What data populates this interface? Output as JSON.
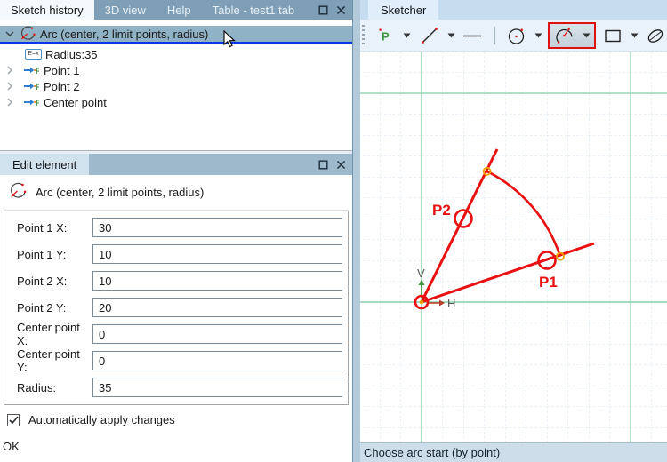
{
  "sketch_history_panel": {
    "tabs": {
      "active": "Sketch history",
      "tab_3d": "3D view",
      "tab_help": "Help",
      "tab_table": "Table - test1.tab"
    },
    "tree": {
      "selected": "Arc (center, 2 limit points, radius)",
      "radius_item": "Radius:35",
      "point1_item": "Point 1",
      "point2_item": "Point 2",
      "center_item": "Center point",
      "expr_icon_text": "E=x",
      "point_icon_letter": "F"
    }
  },
  "edit": {
    "title": "Edit element",
    "element": "Arc (center, 2 limit points, radius)",
    "fields": [
      {
        "label": "Point 1 X:",
        "value": "30"
      },
      {
        "label": "Point 1 Y:",
        "value": "10"
      },
      {
        "label": "Point 2 X:",
        "value": "10"
      },
      {
        "label": "Point 2 Y:",
        "value": "20"
      },
      {
        "label": "Center point X:",
        "value": "0"
      },
      {
        "label": "Center point Y:",
        "value": "0"
      },
      {
        "label": "Radius:",
        "value": "35"
      }
    ],
    "auto_apply_label": "Automatically apply changes",
    "auto_apply_checked": true,
    "ok": "OK"
  },
  "sketcher": {
    "tab": "Sketcher",
    "status": "Choose arc start (by point)",
    "point_tool_letter": "P",
    "canvas_labels": {
      "p1": "P1",
      "p2": "P2",
      "v": "V",
      "h": "H"
    }
  },
  "colors": {
    "accent_red": "#e11010",
    "marker_orange": "#f0a000",
    "selection_underline_blue": "#0b35e8",
    "tree_selection": "#90b2c6",
    "grid_major_green": "#85cfab",
    "grid_minor_blue": "#d2e3f2"
  }
}
